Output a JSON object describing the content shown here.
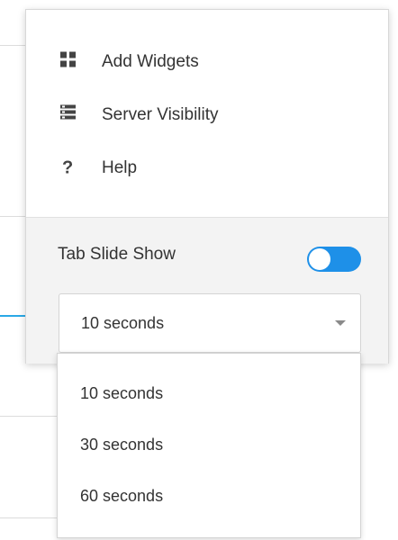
{
  "menu": {
    "items": [
      {
        "label": "Add Widgets",
        "icon": "grid-icon"
      },
      {
        "label": "Server Visibility",
        "icon": "server-icon"
      },
      {
        "label": "Help",
        "icon": "question-icon"
      }
    ]
  },
  "slideshow": {
    "label": "Tab Slide Show",
    "enabled": true,
    "selected": "10 seconds",
    "options": [
      "10 seconds",
      "30 seconds",
      "60 seconds"
    ]
  },
  "colors": {
    "toggle_on": "#1e90e8",
    "accent": "#2aa8e6"
  }
}
